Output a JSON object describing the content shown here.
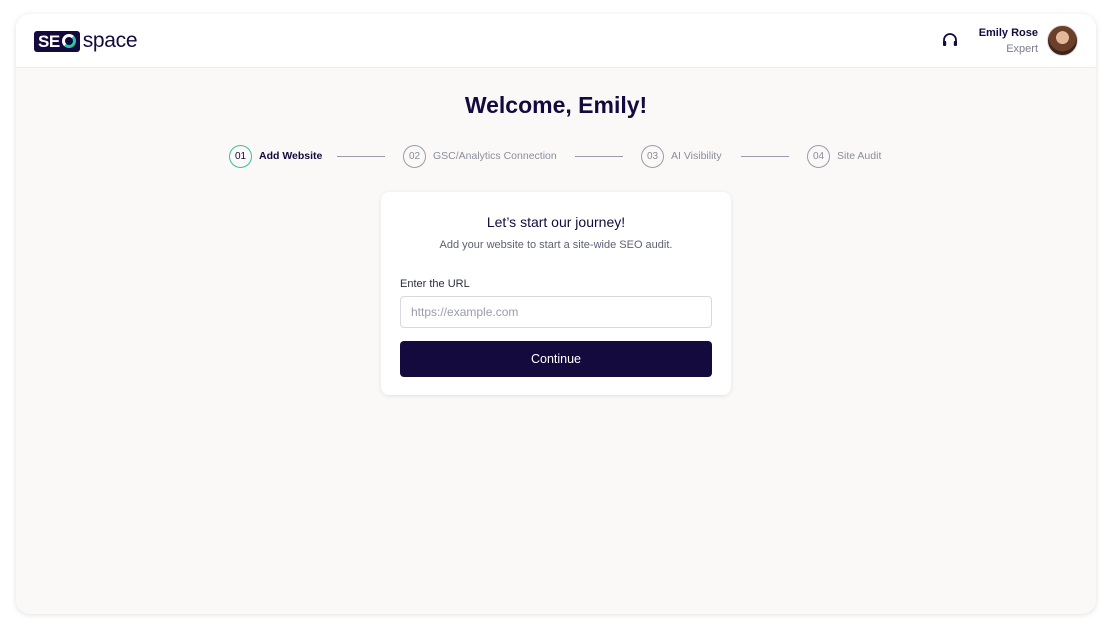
{
  "header": {
    "logo_box_text": "SE",
    "logo_word": "space",
    "support_icon": "headset-icon",
    "user": {
      "name": "Emily Rose",
      "role": "Expert"
    }
  },
  "welcome": "Welcome, Emily!",
  "steps": [
    {
      "number": "01",
      "label": "Add Website",
      "active": true
    },
    {
      "number": "02",
      "label": "GSC/Analytics Connection",
      "active": false
    },
    {
      "number": "03",
      "label": "AI Visibility",
      "active": false
    },
    {
      "number": "04",
      "label": "Site Audit",
      "active": false
    }
  ],
  "card": {
    "title": "Let’s start our journey!",
    "subtitle": "Add your website to start a site-wide SEO audit.",
    "url_label": "Enter the URL",
    "url_placeholder": "https://example.com",
    "url_value": "",
    "button_label": "Continue"
  },
  "colors": {
    "brand_navy": "#140a3d",
    "accent_teal": "#2ec4a0",
    "muted": "#8a8d9c",
    "background": "#faf9f7"
  }
}
